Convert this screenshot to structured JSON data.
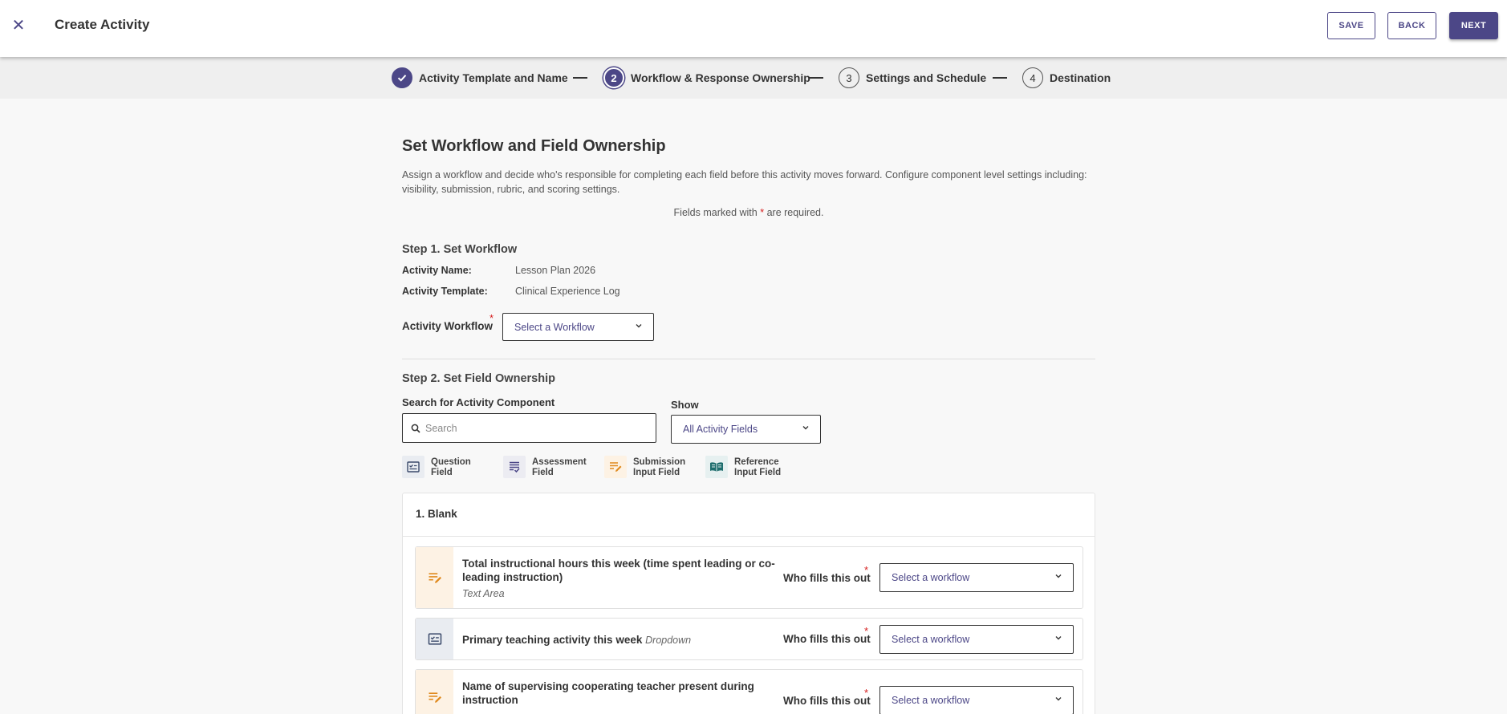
{
  "header": {
    "title": "Create Activity",
    "close_icon": "close-icon",
    "save_label": "SAVE",
    "back_label": "BACK",
    "next_label": "NEXT"
  },
  "stepper": {
    "steps": [
      {
        "number": "✓",
        "label": "Activity Template and Name",
        "state": "done"
      },
      {
        "number": "2",
        "label": "Workflow & Response Ownership",
        "state": "active"
      },
      {
        "number": "3",
        "label": "Settings and Schedule",
        "state": "pending"
      },
      {
        "number": "4",
        "label": "Destination",
        "state": "pending"
      }
    ]
  },
  "main": {
    "heading": "Set Workflow and Field Ownership",
    "description": "Assign a workflow and decide who's responsible for completing each field before this activity moves forward. Configure component level settings including: visibility, submission, rubric, and scoring settings.",
    "required_note_prefix": "Fields marked with",
    "required_note_star": "*",
    "required_note_suffix": "are required.",
    "step1": {
      "title": "Step 1. Set Workflow",
      "activity_name_label": "Activity Name:",
      "activity_name_value": "Lesson Plan 2026",
      "activity_template_label": "Activity Template:",
      "activity_template_value": "Clinical Experience Log",
      "workflow_label": "Activity Workflow",
      "workflow_placeholder": "Select a Workflow"
    },
    "step2": {
      "title": "Step 2. Set Field Ownership",
      "search_label": "Search for Activity Component",
      "search_placeholder": "Search",
      "show_label": "Show",
      "show_value": "All Activity Fields",
      "legend": [
        {
          "line1": "Question",
          "line2": "Field",
          "icon": "question-field-icon"
        },
        {
          "line1": "Assessment",
          "line2": "Field",
          "icon": "assessment-field-icon"
        },
        {
          "line1": "Submission",
          "line2": "Input Field",
          "icon": "submission-input-icon"
        },
        {
          "line1": "Reference",
          "line2": "Input Field",
          "icon": "reference-input-icon"
        }
      ]
    },
    "section": {
      "title": "1. Blank",
      "rows": [
        {
          "title_line1": "Total instructional hours this week (time spent leading or co-",
          "title_line2": "leading instruction)",
          "type": "Text Area",
          "who_label": "Who fills this out",
          "select_placeholder": "Select a workflow",
          "icon": "submission-input-icon"
        },
        {
          "title_line1": "Primary teaching activity this week",
          "type": "Dropdown",
          "who_label": "Who fills this out",
          "select_placeholder": "Select a workflow",
          "icon": "question-field-icon"
        },
        {
          "title_line1": "Name of supervising cooperating teacher present during",
          "title_line2": "instruction",
          "who_label": "Who fills this out",
          "select_placeholder": "Select a workflow",
          "icon": "submission-input-icon"
        }
      ]
    }
  },
  "colors": {
    "brand": "#4c4787",
    "required": "#d62020",
    "submission_bg": "#fdf2e4",
    "question_bg": "#e9ecf1",
    "submission_icon": "#e08a1e",
    "reference_icon": "#1f6e6e"
  }
}
